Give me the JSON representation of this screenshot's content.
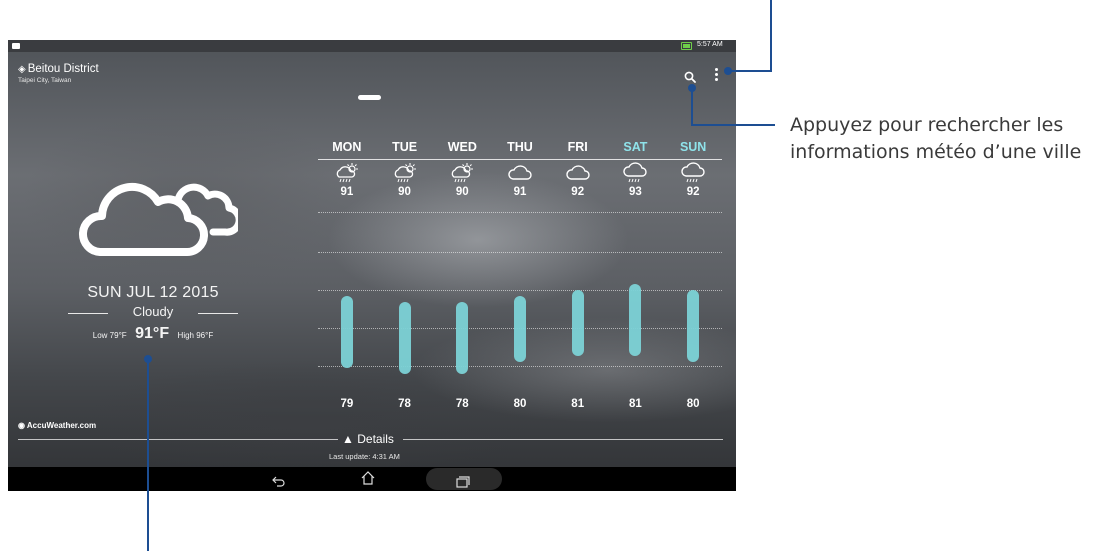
{
  "status_bar": {
    "time": "5:57 AM",
    "battery_color": "#6fd04a"
  },
  "location": {
    "icon": "location-diamond-icon",
    "name": "Beitou District",
    "sub": "Taipei City, Taiwan"
  },
  "top_actions": {
    "search_icon": "search-icon",
    "menu_icon": "more-vert-icon"
  },
  "current": {
    "icon": "cloud-icon",
    "date": "SUN JUL 12 2015",
    "condition": "Cloudy",
    "low_label": "Low 79°F",
    "temp": "91°F",
    "high_label": "High 96°F"
  },
  "forecast": {
    "accent_color": "#7cd2d6",
    "weekend_color": "#8fe3ea",
    "days": [
      {
        "name": "MON",
        "icon": "sun-rain-icon",
        "high": "91",
        "low": "79",
        "weekend": false
      },
      {
        "name": "TUE",
        "icon": "sun-rain-icon",
        "high": "90",
        "low": "78",
        "weekend": false
      },
      {
        "name": "WED",
        "icon": "sun-rain-icon",
        "high": "90",
        "low": "78",
        "weekend": false
      },
      {
        "name": "THU",
        "icon": "cloud-icon",
        "high": "91",
        "low": "80",
        "weekend": false
      },
      {
        "name": "FRI",
        "icon": "cloud-icon",
        "high": "92",
        "low": "81",
        "weekend": false
      },
      {
        "name": "SAT",
        "icon": "cloud-rain-icon",
        "high": "93",
        "low": "81",
        "weekend": true
      },
      {
        "name": "SUN",
        "icon": "cloud-rain-icon",
        "high": "92",
        "low": "80",
        "weekend": true
      }
    ]
  },
  "footer": {
    "brand": "AccuWeather.com",
    "details_label": "Details",
    "last_update": "Last update: 4:31 AM"
  },
  "nav": {
    "back_icon": "back-icon",
    "home_icon": "home-icon",
    "recent_icon": "recent-apps-icon"
  },
  "callouts": {
    "search_text": "Appuyez pour rechercher les informations météo d’une ville",
    "line_color": "#1d4e92"
  }
}
